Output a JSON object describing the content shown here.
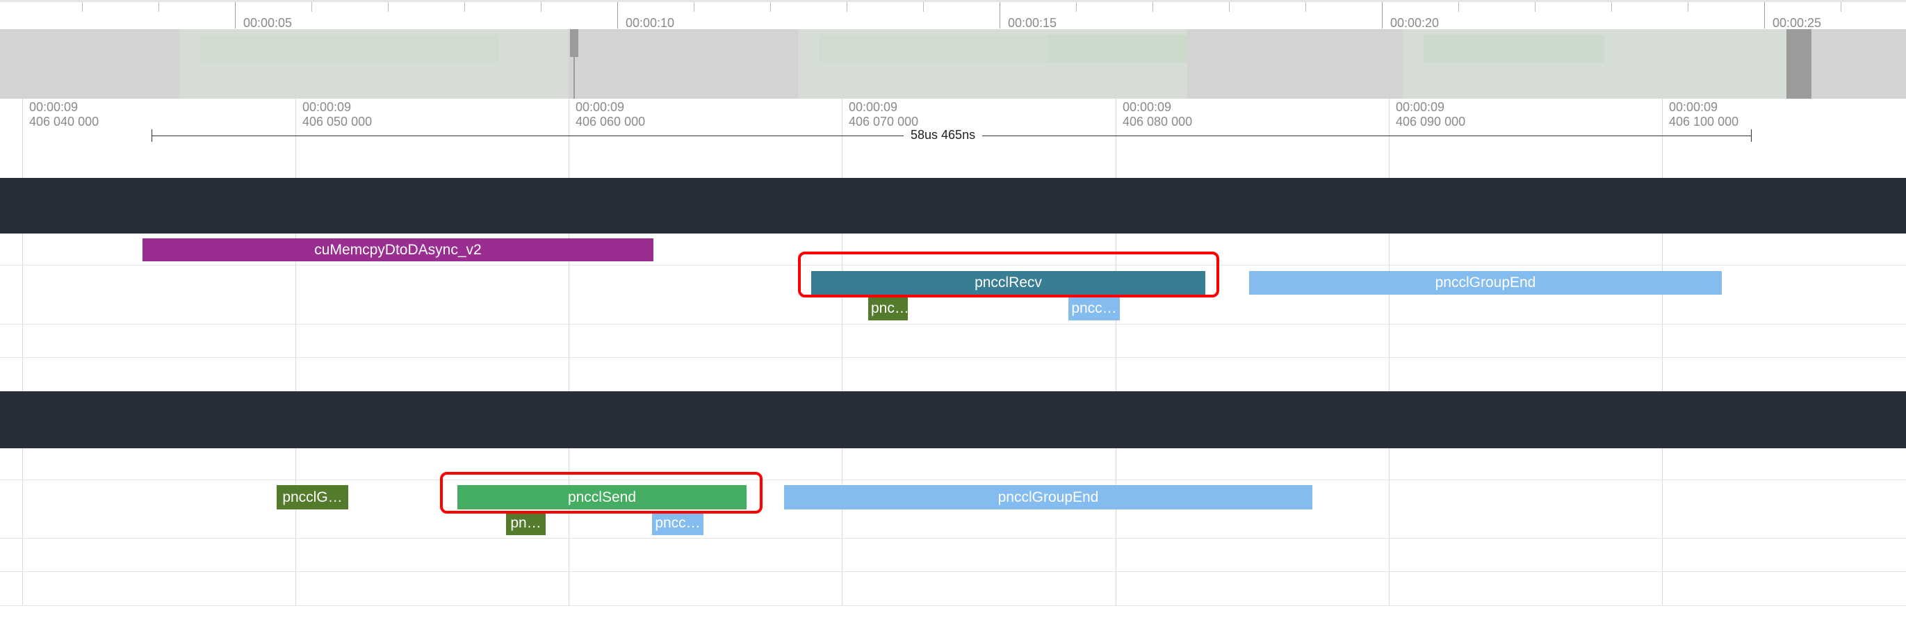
{
  "overview": {
    "time_labels": [
      "00:00:05",
      "00:00:10",
      "00:00:15",
      "00:00:20",
      "00:00:25"
    ]
  },
  "detail": {
    "time_labels": [
      {
        "top": "00:00:09",
        "bottom": "406 040 000"
      },
      {
        "top": "00:00:09",
        "bottom": "406 050 000"
      },
      {
        "top": "00:00:09",
        "bottom": "406 060 000"
      },
      {
        "top": "00:00:09",
        "bottom": "406 070 000"
      },
      {
        "top": "00:00:09",
        "bottom": "406 080 000"
      },
      {
        "top": "00:00:09",
        "bottom": "406 090 000"
      },
      {
        "top": "00:00:09",
        "bottom": "406 100 000"
      }
    ],
    "span_label": "58us 465ns"
  },
  "track1": {
    "slices": {
      "memcpy": "cuMemcpyDtoDAsync_v2",
      "recv": "pncclRecv",
      "group_end": "pncclGroupEnd",
      "child_green": "pnc…",
      "child_blue": "pncc…"
    }
  },
  "track2": {
    "slices": {
      "group_start": "pncclG…",
      "send": "pncclSend",
      "group_end": "pncclGroupEnd",
      "child_green": "pn…",
      "child_blue": "pncc…"
    }
  },
  "colors": {
    "memcpy": "#9a2d90",
    "recv": "#377d93",
    "group_end": "#85bcef",
    "child_green": "#547a2b",
    "send": "#45ad62",
    "header": "#272e3a",
    "highlight": "#ff0000"
  }
}
